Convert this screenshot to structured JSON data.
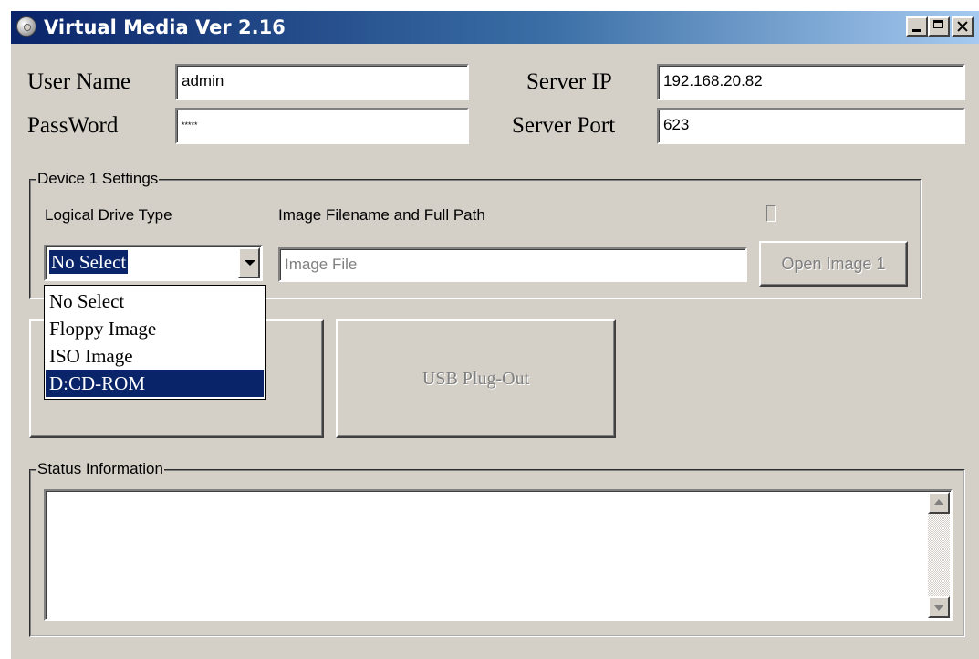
{
  "window": {
    "title": "Virtual Media Ver 2.16",
    "icon": "disc-icon",
    "controls": [
      "minimize-icon",
      "maximize-icon",
      "close-icon"
    ]
  },
  "login": {
    "username_label": "User Name",
    "username_value": "admin",
    "password_label": "PassWord",
    "password_value": "*****",
    "server_ip_label": "Server IP",
    "server_ip_value": "192.168.20.82",
    "server_port_label": "Server Port",
    "server_port_value": "623"
  },
  "device": {
    "group_title": "Device 1 Settings",
    "drive_type_label": "Logical Drive Type",
    "image_path_label": "Image Filename and Full  Path",
    "selected_drive": "No Select",
    "image_placeholder": "Image File",
    "open_button": "Open Image 1",
    "options": [
      {
        "label": "No Select",
        "highlighted": false
      },
      {
        "label": "Floppy Image",
        "highlighted": false
      },
      {
        "label": "ISO Image",
        "highlighted": false
      },
      {
        "label": "D:CD-ROM",
        "highlighted": true
      }
    ]
  },
  "actions": {
    "plug_out_button": "USB Plug-Out"
  },
  "status": {
    "group_title": "Status Information",
    "text": ""
  },
  "colors": {
    "face": "#d4d0c8",
    "highlight": "#0a246a",
    "title_start": "#0a246a",
    "title_end": "#a6caf0",
    "disabled_text": "#808080"
  }
}
